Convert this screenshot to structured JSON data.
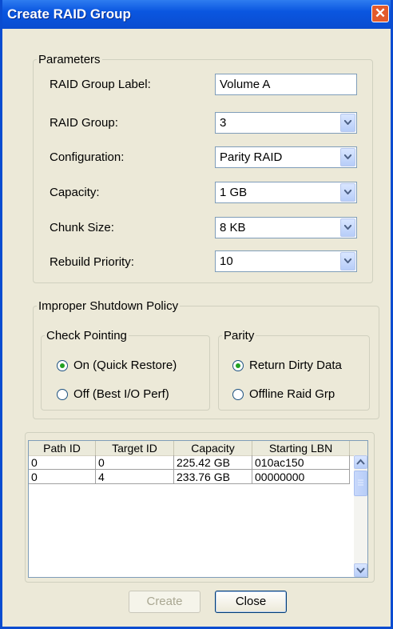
{
  "window": {
    "title": "Create RAID Group",
    "close_glyph": "✕"
  },
  "parameters": {
    "legend": "Parameters",
    "raid_group_label": {
      "label": "RAID Group Label:",
      "value": "Volume A"
    },
    "raid_group": {
      "label": "RAID Group:",
      "value": "3"
    },
    "configuration": {
      "label": "Configuration:",
      "value": "Parity RAID"
    },
    "capacity": {
      "label": "Capacity:",
      "value": "1 GB"
    },
    "chunk_size": {
      "label": "Chunk Size:",
      "value": "8 KB"
    },
    "rebuild_priority": {
      "label": "Rebuild Priority:",
      "value": "10"
    }
  },
  "shutdown_policy": {
    "legend": "Improper Shutdown Policy",
    "check_pointing": {
      "legend": "Check Pointing",
      "options": [
        {
          "label": "On (Quick Restore)",
          "selected": true
        },
        {
          "label": "Off (Best I/O Perf)",
          "selected": false
        }
      ]
    },
    "parity": {
      "legend": "Parity",
      "options": [
        {
          "label": "Return Dirty Data",
          "selected": true
        },
        {
          "label": "Offline Raid Grp",
          "selected": false
        }
      ]
    }
  },
  "table": {
    "columns": [
      "Path ID",
      "Target ID",
      "Capacity",
      "Starting LBN"
    ],
    "rows": [
      [
        "0",
        "0",
        "225.42 GB",
        "010ac150"
      ],
      [
        "0",
        "4",
        "233.76 GB",
        "00000000"
      ]
    ]
  },
  "buttons": {
    "create": "Create",
    "close": "Close"
  },
  "icons": {
    "close": "close-icon",
    "combo_arrow": "chevron-down-icon",
    "scroll_up": "scroll-up-icon",
    "scroll_down": "scroll-down-icon"
  },
  "colors": {
    "title_bar": "#0a4cd0",
    "dialog_bg": "#ece9d8",
    "close_button": "#e35a2b",
    "radio_dot": "#21a121"
  }
}
